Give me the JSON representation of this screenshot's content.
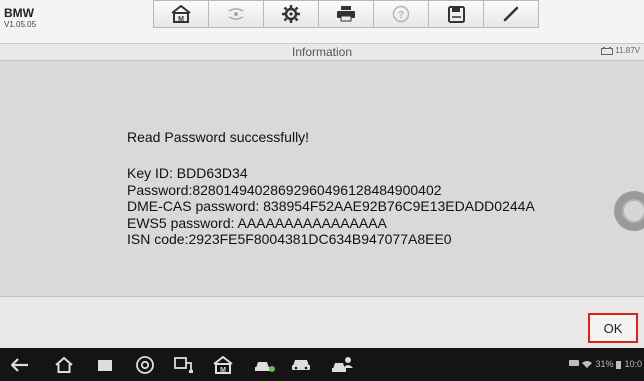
{
  "app": {
    "name": "BMW",
    "version": "V1.05.05"
  },
  "toolbar": {
    "icons": [
      "home-icon",
      "vehicle-swap-icon",
      "settings-gear-icon",
      "print-icon",
      "help-icon",
      "save-icon",
      "pencil-icon"
    ]
  },
  "header": {
    "title": "Information",
    "battery_voltage": "11.87V"
  },
  "result": {
    "message": "Read Password successfully!",
    "lines": [
      "Key ID: BDD63D34",
      "Password:8280149402869296049612848490040​2",
      "DME-CAS password: 838954F52AAE92B76C9E13EDADD0244A",
      "EWS5 password: AAAAAAAAAAAAAAAA",
      "ISN code:2923FE5F8004381DC634B947077A8EE0"
    ]
  },
  "actions": {
    "ok_label": "OK"
  },
  "status": {
    "battery": "31%",
    "time": "10:0"
  },
  "colors": {
    "ok_border": "#e02020",
    "navbar": "#141414"
  }
}
